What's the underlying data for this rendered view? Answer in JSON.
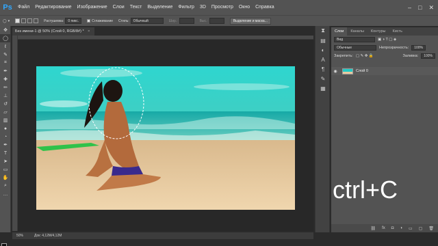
{
  "app": {
    "logo": "Ps",
    "menus": [
      "Файл",
      "Редактирование",
      "Изображение",
      "Слои",
      "Текст",
      "Выделение",
      "Фильтр",
      "3D",
      "Просмотр",
      "Окно",
      "Справка"
    ],
    "window_controls": [
      "–",
      "□",
      "✕"
    ]
  },
  "options_bar": {
    "feather_label": "Растушевка:",
    "feather_value": "0 пикс.",
    "antialias_label": "Сглаживание",
    "style_label": "Стиль:",
    "style_value": "Обычный",
    "width_label": "Шир.:",
    "height_label": "Выс.:",
    "refine_button": "Выделение и маска..."
  },
  "tools": [
    "move-icon",
    "marquee-icon",
    "lasso-icon",
    "quick-select-icon",
    "crop-icon",
    "eyedropper-icon",
    "heal-icon",
    "brush-icon",
    "stamp-icon",
    "history-brush-icon",
    "eraser-icon",
    "gradient-icon",
    "blur-icon",
    "dodge-icon",
    "pen-icon",
    "type-icon",
    "path-select-icon",
    "shape-icon",
    "hand-icon",
    "zoom-icon",
    "more-icon"
  ],
  "document": {
    "tab_title": "Без имени-1 @ 50% (Слой 0, RGB/8#) *",
    "tab_close": "×",
    "status_zoom": "50%",
    "status_doc": "Док: 4,12M/4,12M"
  },
  "layers_panel": {
    "tabs": [
      "Слои",
      "Каналы",
      "Контуры",
      "Кисть"
    ],
    "active_tab": "Слои",
    "filter_value": "Вид",
    "blend_mode": "Обычные",
    "opacity_label": "Непрозрачность:",
    "opacity_value": "100%",
    "lock_label": "Закрепить:",
    "fill_label": "Заливка:",
    "fill_value": "100%",
    "layer_name": "Слой 0"
  },
  "overlay": {
    "text": "ctrl+C"
  },
  "colors": {
    "ui_dark": "#2b2b2b",
    "ui_panel": "#535353",
    "accent": "#31a8ff",
    "sea": "#23c9c4",
    "sand": "#e7c9a0"
  }
}
